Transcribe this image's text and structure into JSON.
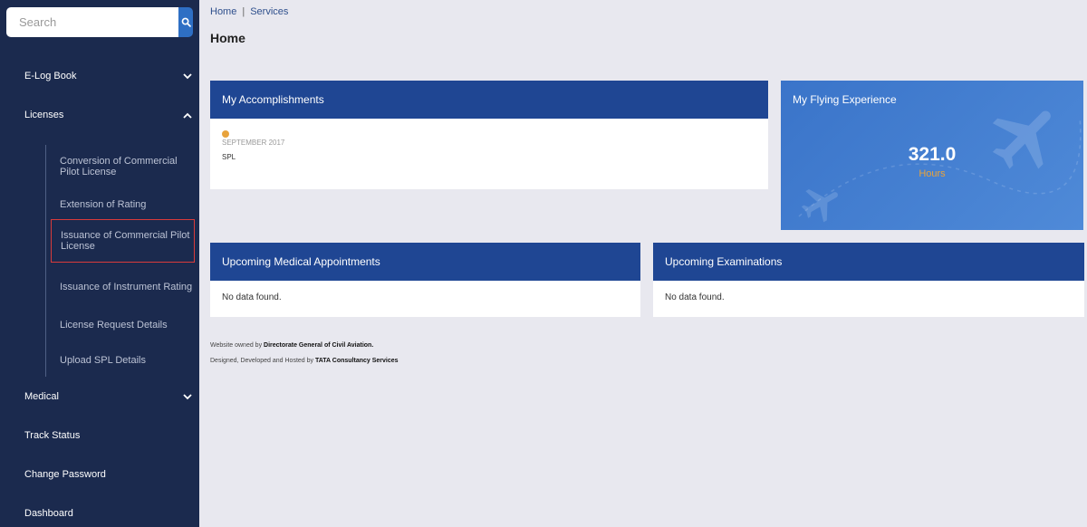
{
  "search": {
    "placeholder": "Search"
  },
  "sidebar": {
    "items": [
      {
        "label": "E-Log Book"
      },
      {
        "label": "Licenses"
      },
      {
        "label": "Medical"
      },
      {
        "label": "Track Status"
      },
      {
        "label": "Change Password"
      },
      {
        "label": "Dashboard"
      }
    ],
    "licenses_sub": [
      {
        "label": "Conversion of Commercial Pilot License"
      },
      {
        "label": "Extension of Rating"
      },
      {
        "label": "Issuance of Commercial Pilot License"
      },
      {
        "label": "Issuance of Instrument Rating"
      },
      {
        "label": "License Request Details"
      },
      {
        "label": "Upload SPL Details"
      }
    ]
  },
  "breadcrumb": {
    "home": "Home",
    "sep": "|",
    "services": "Services"
  },
  "page": {
    "title": "Home"
  },
  "accomplishments": {
    "title": "My Accomplishments",
    "date": "SEPTEMBER 2017",
    "label": "SPL"
  },
  "flying": {
    "title": "My Flying Experience",
    "value": "321.0",
    "unit": "Hours"
  },
  "medical": {
    "title": "Upcoming Medical Appointments",
    "empty": "No data found."
  },
  "exams": {
    "title": "Upcoming Examinations",
    "empty": "No data found."
  },
  "footer": {
    "line1_prefix": "Website owned by",
    "line1_org": "Directorate General of Civil Aviation.",
    "line2_prefix": "Designed, Developed and Hosted by",
    "line2_org": "TATA Consultancy Services"
  },
  "colors": {
    "sidebar": "#1b2a4e",
    "card_header": "#1f4693",
    "accent_orange": "#e8a33c",
    "search_button": "#2e6fc4"
  }
}
